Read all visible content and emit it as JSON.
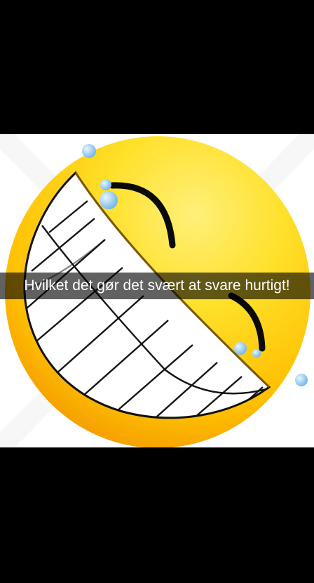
{
  "caption": {
    "text": "Hvilket det gør det svært at svare hurtigt!"
  },
  "image": {
    "subject": "laughing-smiley-emoji",
    "colors": {
      "background": "#000000",
      "face_light": "#ffe84a",
      "face_mid": "#ffc400",
      "face_dark": "#f29a00",
      "teeth": "#ffffff",
      "lines": "#111111",
      "tears": "#8ec9f5"
    }
  }
}
